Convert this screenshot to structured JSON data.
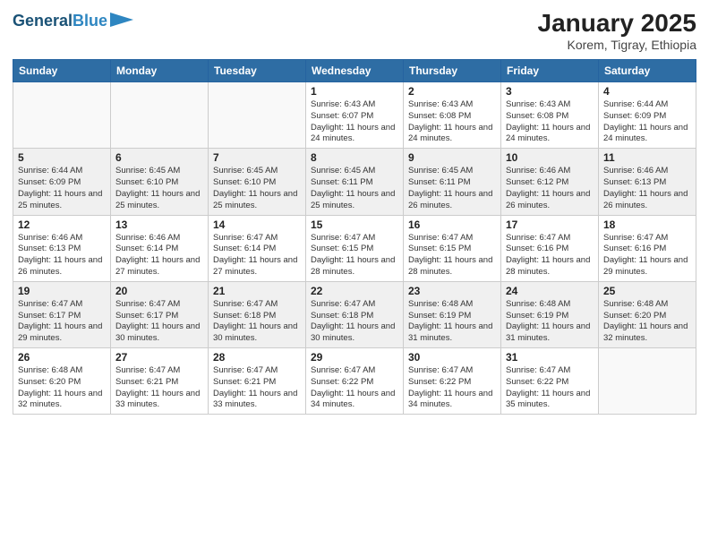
{
  "header": {
    "logo_line1": "General",
    "logo_line2": "Blue",
    "title": "January 2025",
    "subtitle": "Korem, Tigray, Ethiopia"
  },
  "days_of_week": [
    "Sunday",
    "Monday",
    "Tuesday",
    "Wednesday",
    "Thursday",
    "Friday",
    "Saturday"
  ],
  "weeks": [
    {
      "days": [
        {
          "num": "",
          "info": ""
        },
        {
          "num": "",
          "info": ""
        },
        {
          "num": "",
          "info": ""
        },
        {
          "num": "1",
          "info": "Sunrise: 6:43 AM\nSunset: 6:07 PM\nDaylight: 11 hours and 24 minutes."
        },
        {
          "num": "2",
          "info": "Sunrise: 6:43 AM\nSunset: 6:08 PM\nDaylight: 11 hours and 24 minutes."
        },
        {
          "num": "3",
          "info": "Sunrise: 6:43 AM\nSunset: 6:08 PM\nDaylight: 11 hours and 24 minutes."
        },
        {
          "num": "4",
          "info": "Sunrise: 6:44 AM\nSunset: 6:09 PM\nDaylight: 11 hours and 24 minutes."
        }
      ]
    },
    {
      "days": [
        {
          "num": "5",
          "info": "Sunrise: 6:44 AM\nSunset: 6:09 PM\nDaylight: 11 hours and 25 minutes."
        },
        {
          "num": "6",
          "info": "Sunrise: 6:45 AM\nSunset: 6:10 PM\nDaylight: 11 hours and 25 minutes."
        },
        {
          "num": "7",
          "info": "Sunrise: 6:45 AM\nSunset: 6:10 PM\nDaylight: 11 hours and 25 minutes."
        },
        {
          "num": "8",
          "info": "Sunrise: 6:45 AM\nSunset: 6:11 PM\nDaylight: 11 hours and 25 minutes."
        },
        {
          "num": "9",
          "info": "Sunrise: 6:45 AM\nSunset: 6:11 PM\nDaylight: 11 hours and 26 minutes."
        },
        {
          "num": "10",
          "info": "Sunrise: 6:46 AM\nSunset: 6:12 PM\nDaylight: 11 hours and 26 minutes."
        },
        {
          "num": "11",
          "info": "Sunrise: 6:46 AM\nSunset: 6:13 PM\nDaylight: 11 hours and 26 minutes."
        }
      ]
    },
    {
      "days": [
        {
          "num": "12",
          "info": "Sunrise: 6:46 AM\nSunset: 6:13 PM\nDaylight: 11 hours and 26 minutes."
        },
        {
          "num": "13",
          "info": "Sunrise: 6:46 AM\nSunset: 6:14 PM\nDaylight: 11 hours and 27 minutes."
        },
        {
          "num": "14",
          "info": "Sunrise: 6:47 AM\nSunset: 6:14 PM\nDaylight: 11 hours and 27 minutes."
        },
        {
          "num": "15",
          "info": "Sunrise: 6:47 AM\nSunset: 6:15 PM\nDaylight: 11 hours and 28 minutes."
        },
        {
          "num": "16",
          "info": "Sunrise: 6:47 AM\nSunset: 6:15 PM\nDaylight: 11 hours and 28 minutes."
        },
        {
          "num": "17",
          "info": "Sunrise: 6:47 AM\nSunset: 6:16 PM\nDaylight: 11 hours and 28 minutes."
        },
        {
          "num": "18",
          "info": "Sunrise: 6:47 AM\nSunset: 6:16 PM\nDaylight: 11 hours and 29 minutes."
        }
      ]
    },
    {
      "days": [
        {
          "num": "19",
          "info": "Sunrise: 6:47 AM\nSunset: 6:17 PM\nDaylight: 11 hours and 29 minutes."
        },
        {
          "num": "20",
          "info": "Sunrise: 6:47 AM\nSunset: 6:17 PM\nDaylight: 11 hours and 30 minutes."
        },
        {
          "num": "21",
          "info": "Sunrise: 6:47 AM\nSunset: 6:18 PM\nDaylight: 11 hours and 30 minutes."
        },
        {
          "num": "22",
          "info": "Sunrise: 6:47 AM\nSunset: 6:18 PM\nDaylight: 11 hours and 30 minutes."
        },
        {
          "num": "23",
          "info": "Sunrise: 6:48 AM\nSunset: 6:19 PM\nDaylight: 11 hours and 31 minutes."
        },
        {
          "num": "24",
          "info": "Sunrise: 6:48 AM\nSunset: 6:19 PM\nDaylight: 11 hours and 31 minutes."
        },
        {
          "num": "25",
          "info": "Sunrise: 6:48 AM\nSunset: 6:20 PM\nDaylight: 11 hours and 32 minutes."
        }
      ]
    },
    {
      "days": [
        {
          "num": "26",
          "info": "Sunrise: 6:48 AM\nSunset: 6:20 PM\nDaylight: 11 hours and 32 minutes."
        },
        {
          "num": "27",
          "info": "Sunrise: 6:47 AM\nSunset: 6:21 PM\nDaylight: 11 hours and 33 minutes."
        },
        {
          "num": "28",
          "info": "Sunrise: 6:47 AM\nSunset: 6:21 PM\nDaylight: 11 hours and 33 minutes."
        },
        {
          "num": "29",
          "info": "Sunrise: 6:47 AM\nSunset: 6:22 PM\nDaylight: 11 hours and 34 minutes."
        },
        {
          "num": "30",
          "info": "Sunrise: 6:47 AM\nSunset: 6:22 PM\nDaylight: 11 hours and 34 minutes."
        },
        {
          "num": "31",
          "info": "Sunrise: 6:47 AM\nSunset: 6:22 PM\nDaylight: 11 hours and 35 minutes."
        },
        {
          "num": "",
          "info": ""
        }
      ]
    }
  ]
}
